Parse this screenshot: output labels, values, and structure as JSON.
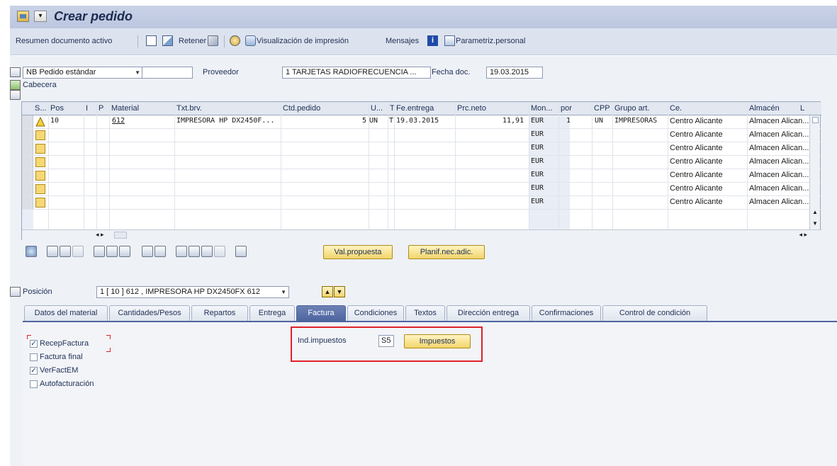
{
  "window": {
    "title": "Crear pedido"
  },
  "toolbar": {
    "resumen": "Resumen documento activo",
    "retener": "Retener",
    "visualizacion": "Visualización de impresión",
    "mensajes": "Mensajes",
    "parametriz": "Parametriz.personal"
  },
  "header": {
    "doc_type": "NB Pedido estándar",
    "doc_number": "",
    "proveedor_label": "Proveedor",
    "proveedor_value": "1 TARJETAS RADIOFRECUENCIA ...",
    "fecha_label": "Fecha doc.",
    "fecha_value": "19.03.2015",
    "cabecera": "Cabecera"
  },
  "grid": {
    "columns": [
      "S...",
      "Pos",
      "I",
      "P",
      "Material",
      "Txt.brv.",
      "Ctd.pedido",
      "U...",
      "T",
      "Fe.entrega",
      "Prc.neto",
      "Mon...",
      "por",
      "CPP",
      "Grupo art.",
      "Ce.",
      "Almacén",
      "L"
    ],
    "rows": [
      {
        "pos": "10",
        "material": "612",
        "txt": "IMPRESORA HP DX2450F...",
        "ctd": "5",
        "un": "UN",
        "t": "T",
        "fecha": "19.03.2015",
        "precio": "11,91",
        "moneda": "EUR",
        "por": "1",
        "cpp": "UN",
        "grupo": "IMPRESORAS",
        "centro": "Centro Alicante",
        "almacen": "Almacen Alican..."
      },
      {
        "moneda": "EUR",
        "centro": "Centro Alicante",
        "almacen": "Almacen Alican..."
      },
      {
        "moneda": "EUR",
        "centro": "Centro Alicante",
        "almacen": "Almacen Alican..."
      },
      {
        "moneda": "EUR",
        "centro": "Centro Alicante",
        "almacen": "Almacen Alican..."
      },
      {
        "moneda": "EUR",
        "centro": "Centro Alicante",
        "almacen": "Almacen Alican..."
      },
      {
        "moneda": "EUR",
        "centro": "Centro Alicante",
        "almacen": "Almacen Alican..."
      },
      {
        "moneda": "EUR",
        "centro": "Centro Alicante",
        "almacen": "Almacen Alican..."
      }
    ]
  },
  "buttons": {
    "valpropuesta": "Val.propuesta",
    "planif": "Planif.nec.adic."
  },
  "position": {
    "label": "Posición",
    "value": "1 [ 10 ] 612 , IMPRESORA HP DX2450FX 612"
  },
  "tabs": [
    "Datos del material",
    "Cantidades/Pesos",
    "Repartos",
    "Entrega",
    "Factura",
    "Condiciones",
    "Textos",
    "Dirección entrega",
    "Confirmaciones",
    "Control de condición"
  ],
  "active_tab": "Factura",
  "factura": {
    "recep_factura": "RecepFactura",
    "recep_factura_checked": true,
    "factura_final": "Factura final",
    "factura_final_checked": false,
    "verfactem": "VerFactEM",
    "verfactem_checked": true,
    "autofacturacion": "Autofacturación",
    "autofacturacion_checked": false,
    "ind_impuestos_label": "Ind.impuestos",
    "ind_impuestos_value": "S5",
    "impuestos_button": "Impuestos"
  },
  "colors": {
    "highlight": "#e0202a",
    "active_tab": "#4d65a0",
    "button": "#f2d56b"
  }
}
